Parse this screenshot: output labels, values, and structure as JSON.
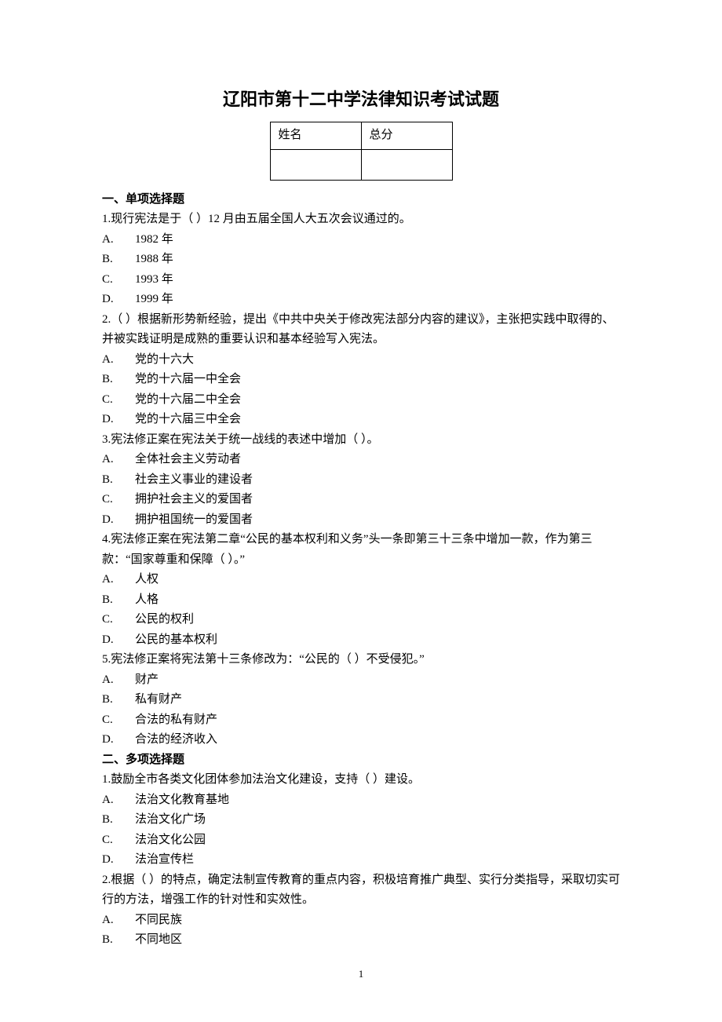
{
  "title": "辽阳市第十二中学法律知识考试试题",
  "info_header": {
    "name": "姓名",
    "score": "总分"
  },
  "section1": "一、单项选择题",
  "s1q1": {
    "text": "1.现行宪法是于（   ）12 月由五届全国人大五次会议通过的。",
    "A": "1982 年",
    "B": "1988 年",
    "C": "1993 年",
    "D": "1999 年"
  },
  "s1q2": {
    "text": "2.（    ）根据新形势新经验，提出《中共中央关于修改宪法部分内容的建议》，主张把实践中取得的、并被实践证明是成熟的重要认识和基本经验写入宪法。",
    "A": "党的十六大",
    "B": "党的十六届一中全会",
    "C": "党的十六届二中全会",
    "D": "党的十六届三中全会"
  },
  "s1q3": {
    "text": "3.宪法修正案在宪法关于统一战线的表述中增加（   ）。",
    "A": "全体社会主义劳动者",
    "B": "社会主义事业的建设者",
    "C": "拥护社会主义的爱国者",
    "D": "拥护祖国统一的爱国者"
  },
  "s1q4": {
    "text": "4.宪法修正案在宪法第二章“公民的基本权利和义务”头一条即第三十三条中增加一款，作为第三款：“国家尊重和保障（   ）。”",
    "A": "人权",
    "B": "人格",
    "C": "公民的权利",
    "D": "公民的基本权利"
  },
  "s1q5": {
    "text": "5.宪法修正案将宪法第十三条修改为：“公民的（   ）不受侵犯。”",
    "A": "财产",
    "B": "私有财产",
    "C": "合法的私有财产",
    "D": "合法的经济收入"
  },
  "section2": "二、多项选择题",
  "s2q1": {
    "text": "1.鼓励全市各类文化团体参加法治文化建设，支持（    ）建设。",
    "A": "法治文化教育基地",
    "B": "法治文化广场",
    "C": "法治文化公园",
    "D": "法治宣传栏"
  },
  "s2q2": {
    "text": "2.根据（    ）的特点，确定法制宣传教育的重点内容，积极培育推广典型、实行分类指导，采取切实可行的方法，增强工作的针对性和实效性。",
    "A": "不同民族",
    "B": "不同地区"
  },
  "letters": {
    "A": "A.",
    "B": "B.",
    "C": "C.",
    "D": "D."
  },
  "pagenum": "1"
}
